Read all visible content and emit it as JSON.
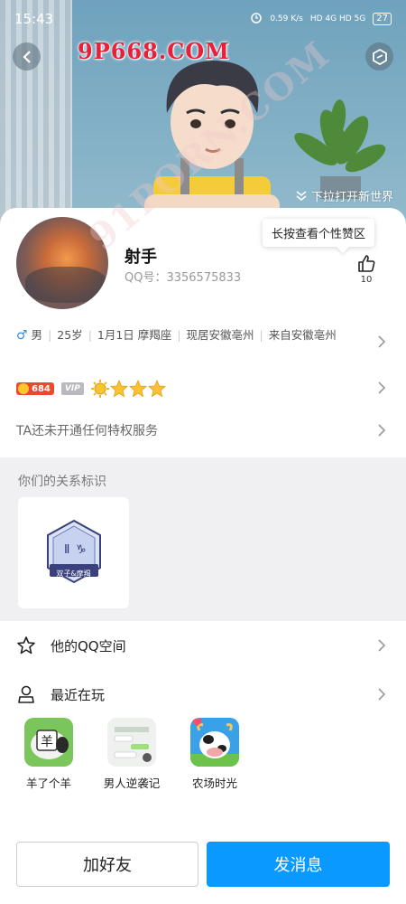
{
  "status_bar": {
    "time": "15:43",
    "speed": "0.59 K/s",
    "network": "HD 4G HD 5G",
    "battery": "27"
  },
  "watermark": "9P668.COM",
  "watermark_diagonal": "91PORN.COM",
  "header": {
    "pull_hint": "下拉打开新世界"
  },
  "profile": {
    "nickname": "射手",
    "qq_label": "QQ号：3356575833",
    "tooltip": "长按查看个性赞区",
    "like_count": "10"
  },
  "info": {
    "gender": "男",
    "age": "25岁",
    "birthday": "1月1日",
    "zodiac": "摩羯座",
    "location": "现居安徽亳州",
    "hometown": "来自安徽亳州"
  },
  "badges": {
    "coin_value": "684",
    "vip_label": "VIP",
    "level_crowns": 1,
    "level_stars": 3
  },
  "privilege_text": "TA还未开通任何特权服务",
  "relation": {
    "title": "你们的关系标识",
    "badge_label": "双子&摩羯"
  },
  "qzone_label": "他的QQ空间",
  "recent": {
    "title": "最近在玩",
    "games": [
      {
        "name": "羊了个羊",
        "icon": "sheep-game-icon"
      },
      {
        "name": "男人逆袭记",
        "icon": "chat-game-icon"
      },
      {
        "name": "农场时光",
        "icon": "cow-farm-icon"
      }
    ]
  },
  "actions": {
    "add_friend": "加好友",
    "send_message": "发消息"
  },
  "colors": {
    "primary": "#0a99ff",
    "male": "#3b8de0",
    "coin": "#e84a2c",
    "section_bg": "#f0f0f3"
  }
}
